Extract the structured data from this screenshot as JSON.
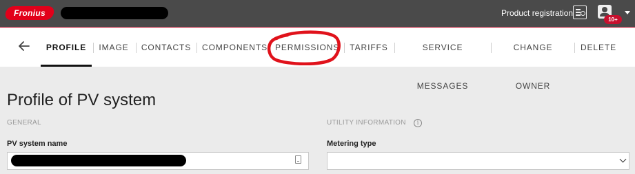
{
  "header": {
    "logo_text": "Fronius",
    "product_registration": "Product registration",
    "notification_badge": "10+"
  },
  "tabs": [
    {
      "label": "PROFILE",
      "active": true
    },
    {
      "label": "IMAGE",
      "active": false
    },
    {
      "label": "CONTACTS",
      "active": false
    },
    {
      "label": "COMPONENTS",
      "active": false
    },
    {
      "label": "PERMISSIONS",
      "active": false
    },
    {
      "label": "TARIFFS",
      "active": false
    },
    {
      "label": "SERVICE MESSAGES",
      "active": false
    },
    {
      "label": "CHANGE OWNER",
      "active": false
    },
    {
      "label": "DELETE",
      "active": false
    }
  ],
  "main": {
    "title": "Profile of PV system",
    "general_section": "GENERAL",
    "utility_section": "UTILITY INFORMATION",
    "pv_name_label": "PV system name",
    "metering_type_label": "Metering type",
    "metering_type_value": ""
  },
  "colors": {
    "header_bg": "#4a4a4a",
    "brand_red": "#e2001a",
    "annotation_red": "#e0121b"
  },
  "icons": {
    "back": "arrow-left-icon",
    "registration": "registration-card-icon",
    "user": "user-account-icon",
    "info": "info-icon",
    "field": "contact-card-icon",
    "dropdown": "chevron-down-icon"
  }
}
